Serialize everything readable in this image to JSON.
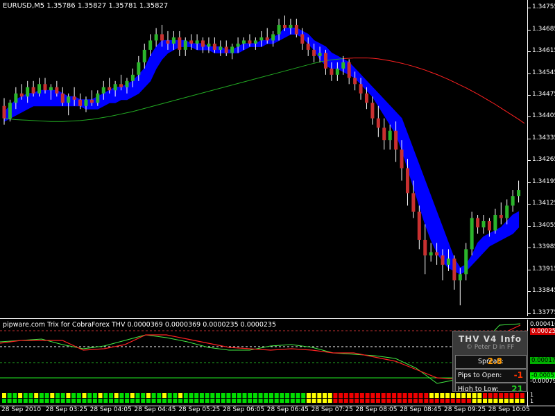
{
  "header": {
    "symbol_line": "EURUSD,M5  1.35786 1.35827 1.35781 1.35827"
  },
  "price_scale": {
    "ticks": [
      "1.34755",
      "1.34685",
      "1.34615",
      "1.34545",
      "1.34475",
      "1.34405",
      "1.34335",
      "1.34265",
      "1.34195",
      "1.34125",
      "1.34055",
      "1.33985",
      "1.33915",
      "1.33845",
      "1.33775"
    ],
    "range": [
      1.33765,
      1.3478
    ]
  },
  "indicator": {
    "title": "pipware.com Trix for CobraForex THV 0.0000369 0.0000369 0.0000235 0.0000235",
    "scale": [
      {
        "label": "0.000416",
        "bg": "",
        "color": "#ffffff"
      },
      {
        "label": "0.00025",
        "bg": "#d00000",
        "color": "#ffffff"
      },
      {
        "label": "0.00017",
        "bg": "#00b000",
        "color": "#000000"
      },
      {
        "label": "-0.0005",
        "bg": "#00e000",
        "color": "#000000"
      },
      {
        "label": "-0.00079",
        "bg": "",
        "color": "#ffffff"
      }
    ],
    "bars_scale": {
      "top": "1",
      "bottom": "1"
    }
  },
  "info_panel": {
    "title": "THV  V4  Info",
    "credit": "© Peter D in FF",
    "spread_label": "Spread:",
    "spread_value": "2.8",
    "pips_label": "Pips to Open:",
    "pips_value": "-1",
    "high_label": "High to Low:",
    "high_value": "21"
  },
  "time_axis": {
    "labels": [
      "28 Sep 2010",
      "28 Sep 03:25",
      "28 Sep 04:05",
      "28 Sep 04:45",
      "28 Sep 05:25",
      "28 Sep 06:05",
      "28 Sep 06:45",
      "28 Sep 07:25",
      "28 Sep 08:05",
      "28 Sep 08:45",
      "28 Sep 09:25",
      "28 Sep 10:05"
    ]
  },
  "colors": {
    "bull": "#2bb52b",
    "bear": "#c83030",
    "cloud": "#0000ff",
    "slow_ma": "#22aa22",
    "slow_ma_late": "#ff2020",
    "trix_green": "#44ee44",
    "trix_red": "#ff2222",
    "bar_green": "#00dd00",
    "bar_yellow": "#ffff00",
    "bar_red": "#ee0000"
  },
  "chart_data": {
    "type": "candlestick",
    "symbol": "EURUSD",
    "timeframe": "M5",
    "candles": [
      [
        1.3444,
        1.34465,
        1.3438,
        1.344
      ],
      [
        1.344,
        1.3446,
        1.3439,
        1.3445
      ],
      [
        1.3445,
        1.345,
        1.3443,
        1.3448
      ],
      [
        1.3448,
        1.3451,
        1.3446,
        1.3447
      ],
      [
        1.3447,
        1.3452,
        1.3445,
        1.345
      ],
      [
        1.345,
        1.3452,
        1.3447,
        1.3448
      ],
      [
        1.3448,
        1.3453,
        1.3447,
        1.3451
      ],
      [
        1.3451,
        1.3453,
        1.3448,
        1.3449
      ],
      [
        1.3449,
        1.3451,
        1.3446,
        1.345
      ],
      [
        1.345,
        1.3452,
        1.3447,
        1.3448
      ],
      [
        1.3448,
        1.345,
        1.3444,
        1.3445
      ],
      [
        1.3445,
        1.3448,
        1.3441,
        1.3447
      ],
      [
        1.3447,
        1.345,
        1.3444,
        1.3446
      ],
      [
        1.3446,
        1.3448,
        1.3443,
        1.3444
      ],
      [
        1.3444,
        1.3447,
        1.3442,
        1.3446
      ],
      [
        1.3446,
        1.3449,
        1.3444,
        1.3445
      ],
      [
        1.3445,
        1.3449,
        1.3444,
        1.3448
      ],
      [
        1.3448,
        1.3452,
        1.3446,
        1.345
      ],
      [
        1.345,
        1.3453,
        1.3448,
        1.3449
      ],
      [
        1.3449,
        1.3452,
        1.3447,
        1.3451
      ],
      [
        1.3451,
        1.3454,
        1.3449,
        1.345
      ],
      [
        1.345,
        1.3453,
        1.3448,
        1.3452
      ],
      [
        1.3452,
        1.3456,
        1.345,
        1.3454
      ],
      [
        1.3454,
        1.346,
        1.3452,
        1.3458
      ],
      [
        1.3458,
        1.3464,
        1.3456,
        1.3462
      ],
      [
        1.3462,
        1.3467,
        1.346,
        1.3465
      ],
      [
        1.3465,
        1.3469,
        1.3463,
        1.3467
      ],
      [
        1.3467,
        1.347,
        1.3463,
        1.3465
      ],
      [
        1.3465,
        1.3468,
        1.3462,
        1.3464
      ],
      [
        1.3464,
        1.3468,
        1.3462,
        1.3466
      ],
      [
        1.3466,
        1.3468,
        1.346,
        1.3462
      ],
      [
        1.3462,
        1.3466,
        1.346,
        1.3465
      ],
      [
        1.3465,
        1.3467,
        1.3462,
        1.3464
      ],
      [
        1.3464,
        1.3467,
        1.3462,
        1.3465
      ],
      [
        1.3465,
        1.3466,
        1.3461,
        1.3463
      ],
      [
        1.3463,
        1.3466,
        1.3461,
        1.3464
      ],
      [
        1.3464,
        1.3466,
        1.3461,
        1.3462
      ],
      [
        1.3462,
        1.3465,
        1.346,
        1.3463
      ],
      [
        1.3463,
        1.3465,
        1.346,
        1.3461
      ],
      [
        1.3461,
        1.3464,
        1.3459,
        1.3463
      ],
      [
        1.3463,
        1.3466,
        1.3461,
        1.3464
      ],
      [
        1.3464,
        1.3466,
        1.3462,
        1.3465
      ],
      [
        1.3465,
        1.3467,
        1.3463,
        1.3464
      ],
      [
        1.3464,
        1.3466,
        1.3462,
        1.3465
      ],
      [
        1.3465,
        1.3468,
        1.3463,
        1.3466
      ],
      [
        1.3466,
        1.3469,
        1.3464,
        1.3465
      ],
      [
        1.3465,
        1.3468,
        1.3463,
        1.3467
      ],
      [
        1.3467,
        1.3472,
        1.3465,
        1.347
      ],
      [
        1.347,
        1.3473,
        1.3468,
        1.3469
      ],
      [
        1.3469,
        1.3472,
        1.3467,
        1.347
      ],
      [
        1.347,
        1.3472,
        1.3466,
        1.3467
      ],
      [
        1.3467,
        1.3469,
        1.3462,
        1.3464
      ],
      [
        1.3464,
        1.3466,
        1.346,
        1.3462
      ],
      [
        1.3462,
        1.3464,
        1.3458,
        1.346
      ],
      [
        1.346,
        1.3463,
        1.3458,
        1.3461
      ],
      [
        1.3461,
        1.3462,
        1.3454,
        1.3456
      ],
      [
        1.3456,
        1.3458,
        1.3452,
        1.3454
      ],
      [
        1.3454,
        1.3458,
        1.3452,
        1.3456
      ],
      [
        1.3456,
        1.346,
        1.3454,
        1.3458
      ],
      [
        1.3458,
        1.3459,
        1.3451,
        1.3453
      ],
      [
        1.3453,
        1.3455,
        1.3449,
        1.3451
      ],
      [
        1.3451,
        1.3453,
        1.3446,
        1.3448
      ],
      [
        1.3448,
        1.345,
        1.3443,
        1.3445
      ],
      [
        1.3445,
        1.3447,
        1.3438,
        1.344
      ],
      [
        1.344,
        1.3444,
        1.3434,
        1.3437
      ],
      [
        1.3437,
        1.344,
        1.343,
        1.3433
      ],
      [
        1.3433,
        1.3438,
        1.343,
        1.3436
      ],
      [
        1.3436,
        1.3439,
        1.3426,
        1.343
      ],
      [
        1.343,
        1.3433,
        1.342,
        1.3424
      ],
      [
        1.3424,
        1.3427,
        1.3412,
        1.3416
      ],
      [
        1.3416,
        1.342,
        1.3408,
        1.341
      ],
      [
        1.341,
        1.3412,
        1.3398,
        1.3401
      ],
      [
        1.3401,
        1.3406,
        1.339,
        1.3396
      ],
      [
        1.3396,
        1.34,
        1.3394,
        1.3397
      ],
      [
        1.3397,
        1.34,
        1.3393,
        1.3396
      ],
      [
        1.3396,
        1.3398,
        1.3388,
        1.3393
      ],
      [
        1.3393,
        1.3398,
        1.3391,
        1.3395
      ],
      [
        1.3395,
        1.3396,
        1.3385,
        1.3388
      ],
      [
        1.3388,
        1.3392,
        1.338,
        1.339
      ],
      [
        1.339,
        1.34,
        1.3388,
        1.3398
      ],
      [
        1.3398,
        1.341,
        1.3396,
        1.3408
      ],
      [
        1.3408,
        1.3409,
        1.3403,
        1.3405
      ],
      [
        1.3405,
        1.3409,
        1.3403,
        1.3407
      ],
      [
        1.3407,
        1.3408,
        1.3402,
        1.3404
      ],
      [
        1.3404,
        1.3411,
        1.3403,
        1.3409
      ],
      [
        1.3409,
        1.3413,
        1.3406,
        1.3408
      ],
      [
        1.3408,
        1.3414,
        1.3406,
        1.3412
      ],
      [
        1.3412,
        1.3417,
        1.341,
        1.3415
      ],
      [
        1.3415,
        1.342,
        1.3413,
        1.3417
      ]
    ],
    "cloud_upper": [
      1.3442,
      1.3444,
      1.3446,
      1.3447,
      1.3448,
      1.3448,
      1.3449,
      1.3449,
      1.3449,
      1.3449,
      1.3448,
      1.3447,
      1.3447,
      1.3446,
      1.3446,
      1.3446,
      1.3447,
      1.3448,
      1.3449,
      1.345,
      1.345,
      1.3451,
      1.3452,
      1.3454,
      1.3456,
      1.346,
      1.3463,
      1.3465,
      1.3465,
      1.3465,
      1.3465,
      1.3465,
      1.3464,
      1.3464,
      1.3464,
      1.3463,
      1.3463,
      1.3463,
      1.3462,
      1.3462,
      1.3463,
      1.3464,
      1.3464,
      1.3464,
      1.3465,
      1.3465,
      1.3466,
      1.3467,
      1.3469,
      1.3469,
      1.3469,
      1.3468,
      1.3467,
      1.3465,
      1.3464,
      1.3463,
      1.3461,
      1.346,
      1.3459,
      1.3458,
      1.3456,
      1.3454,
      1.3452,
      1.345,
      1.3448,
      1.3446,
      1.3444,
      1.3442,
      1.344,
      1.3435,
      1.343,
      1.3425,
      1.342,
      1.3415,
      1.341,
      1.3405,
      1.34,
      1.3395,
      1.3392,
      1.3393,
      1.3396,
      1.34,
      1.3402,
      1.3403,
      1.3404,
      1.3405,
      1.3407,
      1.3409,
      1.341
    ],
    "cloud_lower": [
      1.3439,
      1.344,
      1.3441,
      1.3442,
      1.3443,
      1.3444,
      1.3444,
      1.3444,
      1.3444,
      1.3444,
      1.3444,
      1.3444,
      1.3444,
      1.3444,
      1.3443,
      1.3443,
      1.3443,
      1.3444,
      1.3445,
      1.3445,
      1.3446,
      1.3446,
      1.3447,
      1.3448,
      1.345,
      1.3452,
      1.3456,
      1.3459,
      1.3461,
      1.3462,
      1.3463,
      1.3463,
      1.3463,
      1.3462,
      1.3462,
      1.3462,
      1.3461,
      1.3461,
      1.3461,
      1.3461,
      1.3461,
      1.3462,
      1.3463,
      1.3463,
      1.3463,
      1.3464,
      1.3464,
      1.3465,
      1.3466,
      1.3467,
      1.3467,
      1.3466,
      1.3464,
      1.3462,
      1.3459,
      1.3457,
      1.3456,
      1.3456,
      1.3455,
      1.3454,
      1.3453,
      1.3451,
      1.3449,
      1.3447,
      1.3444,
      1.3441,
      1.3438,
      1.3435,
      1.343,
      1.3424,
      1.3418,
      1.3412,
      1.3406,
      1.3401,
      1.3397,
      1.3394,
      1.3392,
      1.3391,
      1.339,
      1.3391,
      1.3393,
      1.3395,
      1.3397,
      1.3399,
      1.34,
      1.3401,
      1.3402,
      1.3403,
      1.3405
    ],
    "slow_ma": [
      1.344,
      1.34398,
      1.34396,
      1.34395,
      1.34394,
      1.34393,
      1.34392,
      1.34391,
      1.3439,
      1.3439,
      1.3439,
      1.34391,
      1.34392,
      1.34393,
      1.34395,
      1.34397,
      1.344,
      1.34403,
      1.34406,
      1.3441,
      1.34414,
      1.34418,
      1.34422,
      1.34427,
      1.34432,
      1.34437,
      1.34442,
      1.34447,
      1.34452,
      1.34457,
      1.34462,
      1.34467,
      1.34472,
      1.34477,
      1.34482,
      1.34487,
      1.34492,
      1.34497,
      1.34502,
      1.34507,
      1.34512,
      1.34517,
      1.34522,
      1.34527,
      1.34532,
      1.34537,
      1.34542,
      1.34547,
      1.34552,
      1.34557,
      1.34562,
      1.34567,
      1.34572,
      1.34577,
      1.34581,
      1.34585,
      1.34588,
      1.3459,
      1.34592,
      1.34593,
      1.34594,
      1.34594,
      1.34594,
      1.34593,
      1.34591,
      1.34588,
      1.34585,
      1.34581,
      1.34577,
      1.34572,
      1.34567,
      1.34561,
      1.34555,
      1.34548,
      1.34541,
      1.34533,
      1.34525,
      1.34516,
      1.34507,
      1.34498,
      1.34488,
      1.34478,
      1.34467,
      1.34456,
      1.34445,
      1.34433,
      1.34421,
      1.34409,
      1.34397,
      1.34384
    ]
  }
}
